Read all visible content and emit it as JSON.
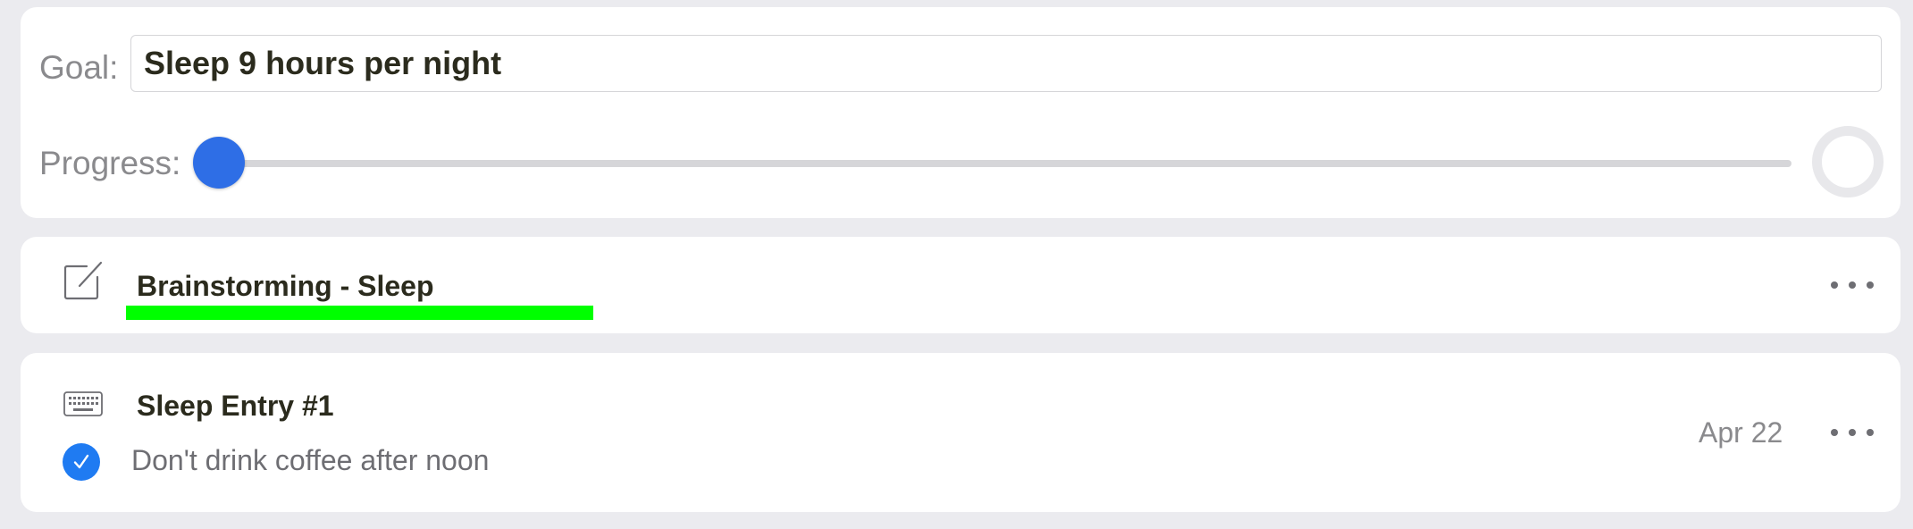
{
  "goal": {
    "label": "Goal:",
    "value": "Sleep 9 hours per night"
  },
  "progress": {
    "label": "Progress:",
    "value": 0,
    "accent_color": "#2e6ee6"
  },
  "brainstorm": {
    "icon": "compose-icon",
    "title": "Brainstorming - Sleep",
    "highlight_color": "#00ff00",
    "menu_icon": "more-icon"
  },
  "entry": {
    "icon": "keyboard-icon",
    "title": "Sleep Entry #1",
    "date": "Apr 22",
    "completed": true,
    "check_color": "#1f7bf2",
    "subtitle": "Don't drink coffee after noon",
    "menu_icon": "more-icon"
  }
}
